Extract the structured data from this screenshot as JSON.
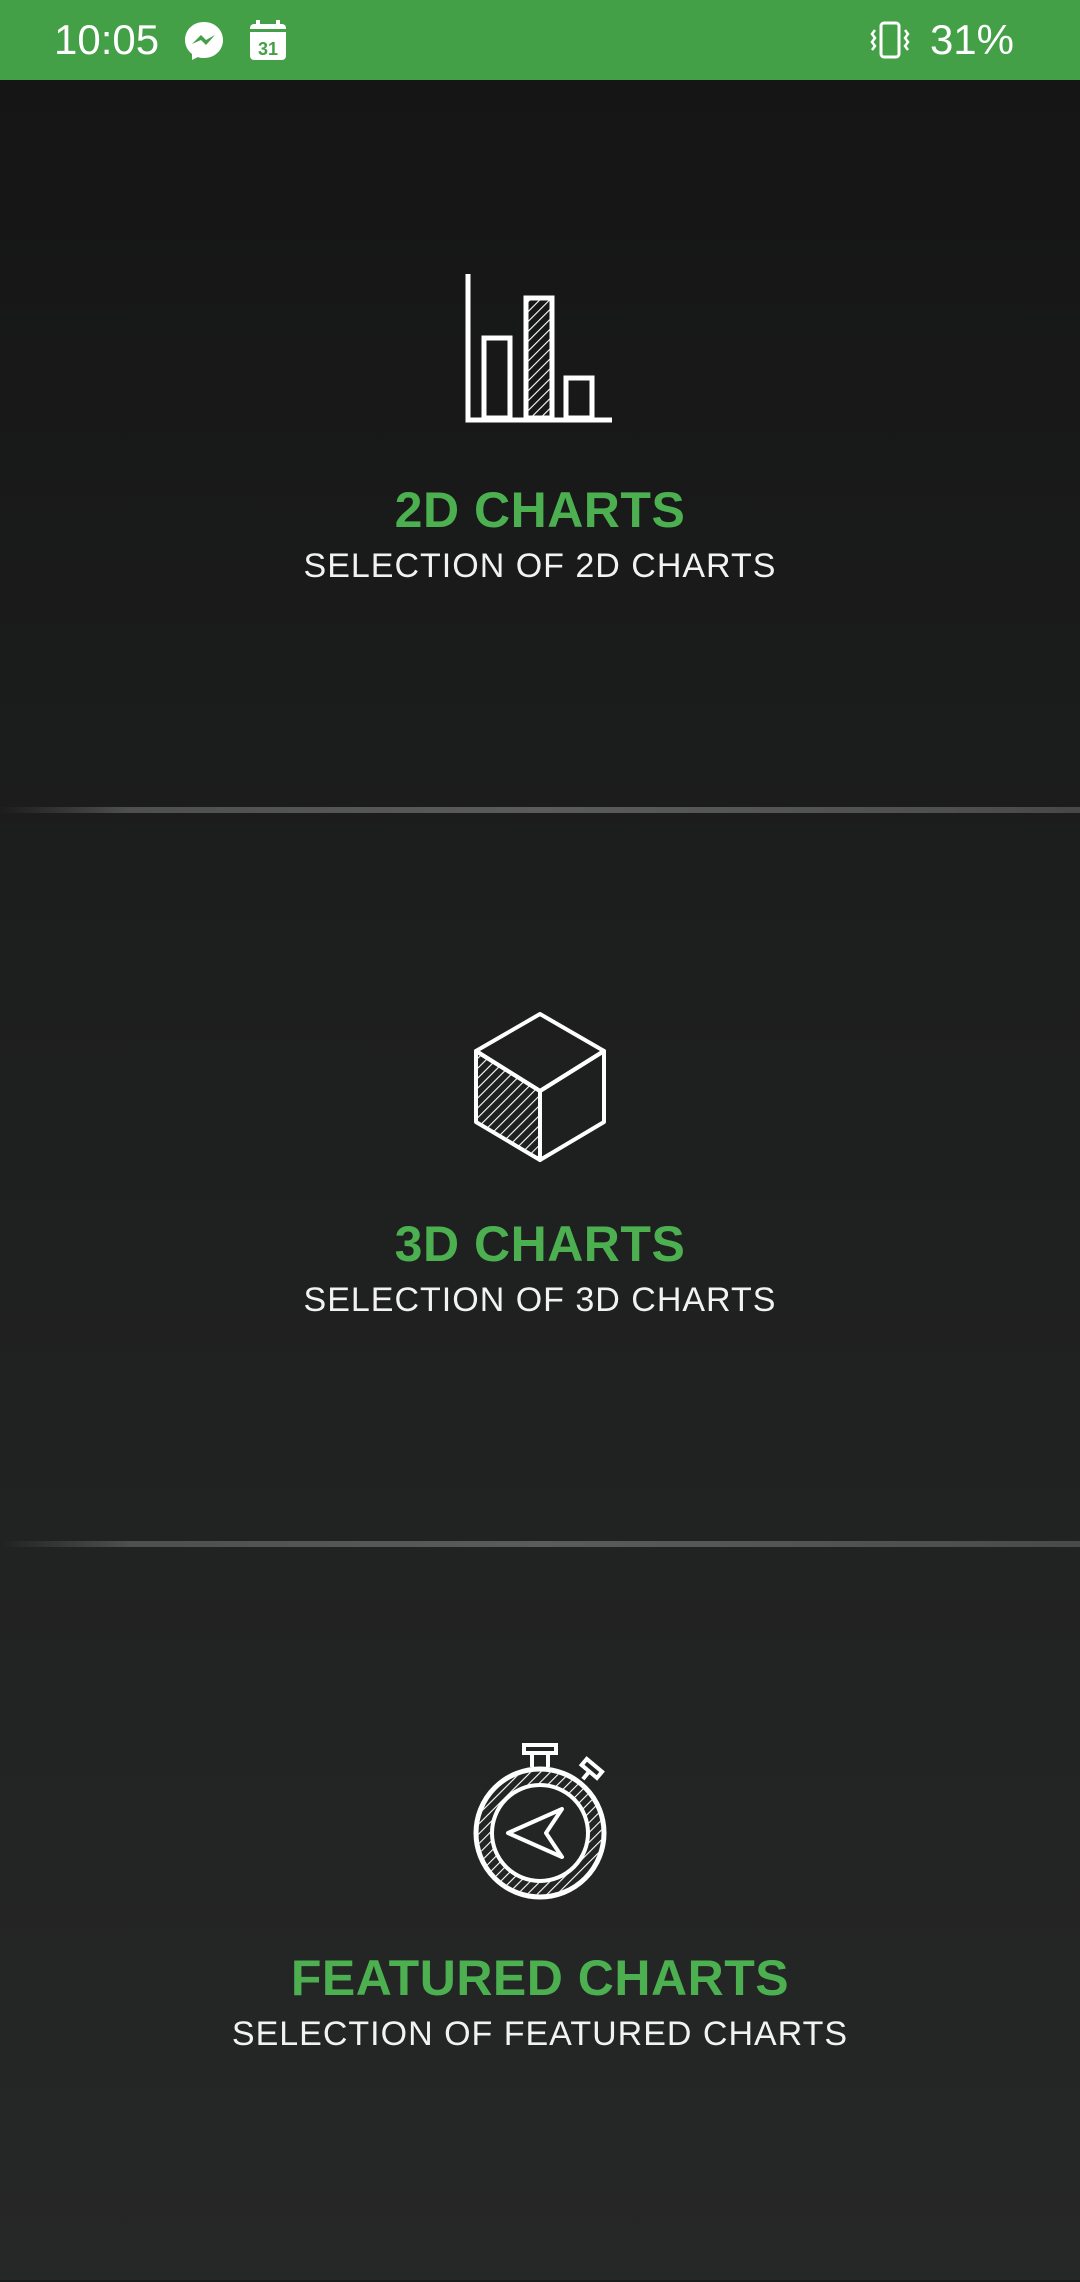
{
  "status_bar": {
    "time": "10:05",
    "battery": "31%",
    "icons": [
      "messenger-icon",
      "calendar-icon",
      "vibrate-icon"
    ],
    "calendar_day": "31",
    "color": "#43a047"
  },
  "sections": [
    {
      "icon": "bar-chart-icon",
      "title": "2D CHARTS",
      "subtitle": "SELECTION OF 2D CHARTS"
    },
    {
      "icon": "cube-icon",
      "title": "3D CHARTS",
      "subtitle": "SELECTION OF 3D CHARTS"
    },
    {
      "icon": "stopwatch-icon",
      "title": "FEATURED CHARTS",
      "subtitle": "SELECTION OF FEATURED CHARTS"
    }
  ],
  "colors": {
    "accent": "#4caf50",
    "background": "#1a1a1a",
    "text": "#f2f2f2"
  }
}
